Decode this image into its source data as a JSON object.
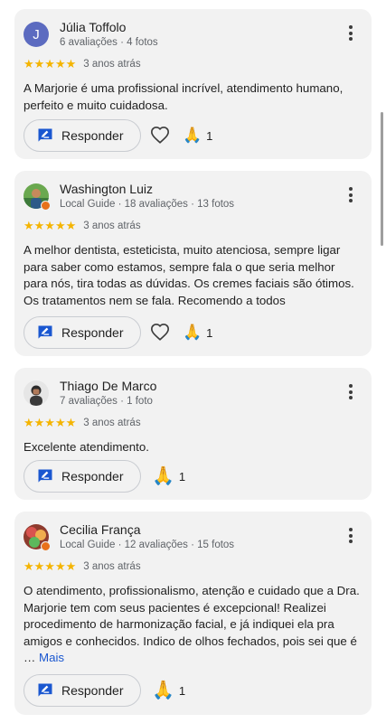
{
  "reply_label": "Responder",
  "reviews": [
    {
      "name": "Júlia Toffolo",
      "avatar_letter": "J",
      "meta": "6 avaliações · 4 fotos",
      "stars": "★★★★★",
      "age": "3 anos atrás",
      "text": "A Marjorie é uma profissional incrível, atendimento humano, perfeito e muito cuidadosa.",
      "reaction_count": "1"
    },
    {
      "name": "Washington Luiz",
      "meta": "Local Guide · 18 avaliações · 13 fotos",
      "stars": "★★★★★",
      "age": "3 anos atrás",
      "text": "A melhor dentista, esteticista, muito atenciosa, sempre ligar para saber como estamos, sempre fala o que seria melhor para nós, tira todas as dúvidas. Os cremes faciais são ótimos. Os tratamentos nem se fala. Recomendo a todos",
      "reaction_count": "1"
    },
    {
      "name": "Thiago De Marco",
      "meta": "7 avaliações · 1 foto",
      "stars": "★★★★★",
      "age": "3 anos atrás",
      "text": "Excelente atendimento.",
      "reaction_count": "1"
    },
    {
      "name": "Cecilia França",
      "meta": "Local Guide · 12 avaliações · 15 fotos",
      "stars": "★★★★★",
      "age": "3 anos atrás",
      "text": "O atendimento, profissionalismo, atenção e cuidado que a Dra. Marjorie tem com seus pacientes é excepcional! Realizei procedimento de harmonização facial, e já indiquei ela pra amigos e conhecidos. Indico de olhos fechados, pois sei que é …",
      "more_label": "Mais",
      "reaction_count": "1"
    }
  ],
  "icons": {
    "reply": "reply-icon",
    "like": "heart-icon",
    "reaction": "praying-hands-icon",
    "menu": "more-vert-icon"
  },
  "colors": {
    "card_bg": "#f2f2f2",
    "star": "#f4b400",
    "link": "#1a57d0",
    "reply_icon": "#1a57d0",
    "local_guide_badge": "#e8711a"
  }
}
